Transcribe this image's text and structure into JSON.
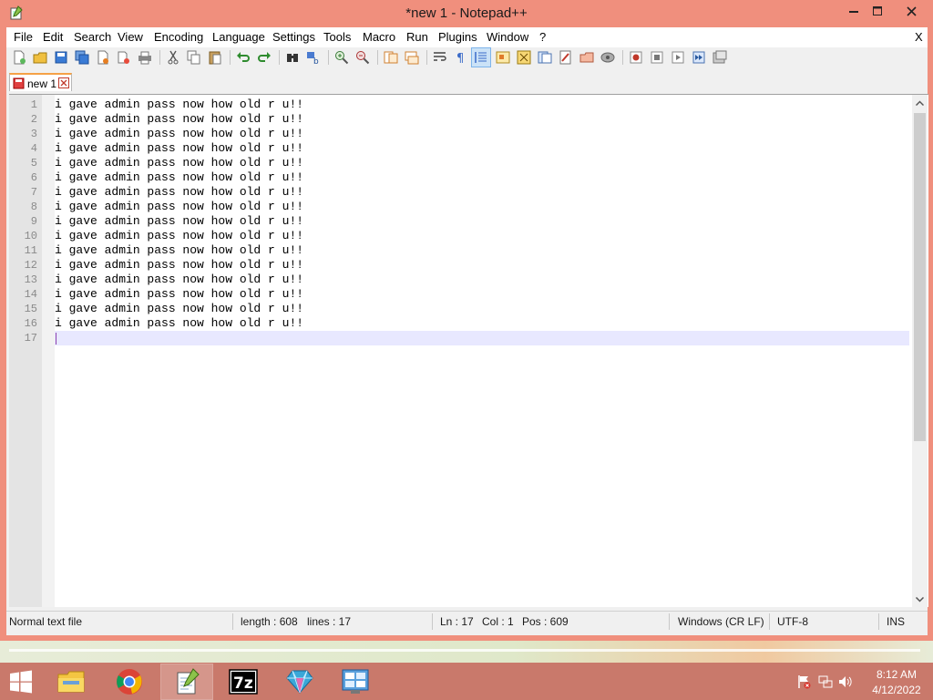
{
  "window": {
    "title": "*new 1 - Notepad++",
    "caption_buttons": {
      "minimize": "—",
      "maximize": "☐",
      "close": "✕"
    }
  },
  "menu": {
    "items": [
      "File",
      "Edit",
      "Search",
      "View",
      "Encoding",
      "Language",
      "Settings",
      "Tools",
      "Macro",
      "Run",
      "Plugins",
      "Window",
      "?"
    ],
    "close_doc": "X"
  },
  "toolbar": {
    "buttons": [
      "new-file",
      "open-file",
      "save",
      "save-all",
      "close",
      "close-all",
      "print",
      "cut",
      "copy",
      "paste",
      "undo",
      "redo",
      "find",
      "replace",
      "zoom-in",
      "zoom-out",
      "sync-vertical",
      "sync-horizontal",
      "word-wrap",
      "show-all-chars",
      "indent-guide",
      "user-defined-language",
      "document-map",
      "function-list",
      "folder-as-workspace",
      "monitoring",
      "start-recording",
      "stop-recording",
      "playback",
      "run-macro-multiple",
      "save-macro"
    ],
    "active": "indent-guide"
  },
  "tabs": [
    {
      "label": "new 1",
      "modified": true
    }
  ],
  "editor": {
    "lines": [
      "i gave admin pass now how old r u!!",
      "i gave admin pass now how old r u!!",
      "i gave admin pass now how old r u!!",
      "i gave admin pass now how old r u!!",
      "i gave admin pass now how old r u!!",
      "i gave admin pass now how old r u!!",
      "i gave admin pass now how old r u!!",
      "i gave admin pass now how old r u!!",
      "i gave admin pass now how old r u!!",
      "i gave admin pass now how old r u!!",
      "i gave admin pass now how old r u!!",
      "i gave admin pass now how old r u!!",
      "i gave admin pass now how old r u!!",
      "i gave admin pass now how old r u!!",
      "i gave admin pass now how old r u!!",
      "i gave admin pass now how old r u!!",
      ""
    ],
    "current_line": 17
  },
  "status": {
    "file_type": "Normal text file",
    "length": "length : 608",
    "lines": "lines : 17",
    "ln": "Ln : 17",
    "col": "Col : 1",
    "pos": "Pos : 609",
    "eol": "Windows (CR LF)",
    "encoding": "UTF-8",
    "mode": "INS"
  },
  "taskbar": {
    "items": [
      "file-explorer",
      "chrome",
      "notepad-plus-plus",
      "7-zip",
      "gem-app",
      "control-panel"
    ],
    "active": "notepad-plus-plus",
    "clock": {
      "time": "8:12 AM",
      "date": "4/12/2022"
    }
  },
  "colors": {
    "titlebar": "#f08f7d",
    "taskbar": "#c9796b",
    "current_line": "#e8e8ff",
    "tab_accent": "#f5a146"
  }
}
